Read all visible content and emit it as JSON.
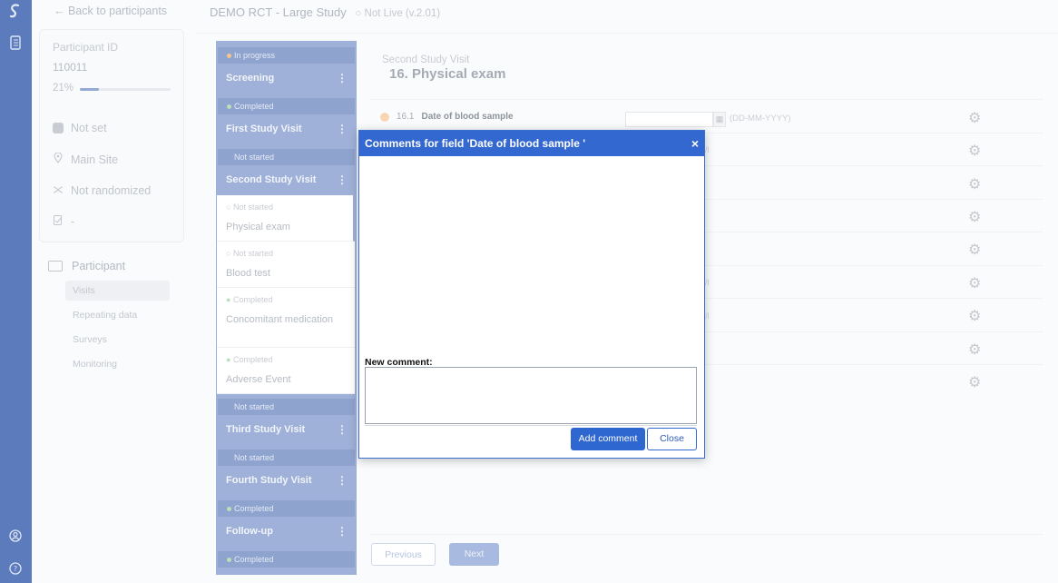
{
  "rail": {
    "icons": [
      "logo-icon",
      "notebook-icon",
      "user-icon",
      "help-icon"
    ]
  },
  "participant": {
    "back_label": "← Back to participants",
    "id_label": "Participant ID",
    "id_value": "110011",
    "progress_text": "21%",
    "progress_value": 0.21,
    "status": "Not set",
    "site": "Main Site",
    "randomization": "Not randomized",
    "extra": "-"
  },
  "nav": {
    "heading": "Participant",
    "items": [
      "Visits",
      "Repeating data",
      "Surveys",
      "Monitoring"
    ]
  },
  "header": {
    "study": "DEMO RCT - Large Study",
    "status": "Not Live (v.2.01)"
  },
  "visits": [
    {
      "status": "In progress",
      "name": "Screening"
    },
    {
      "status": "Completed",
      "name": "First Study Visit"
    },
    {
      "status": "Not started",
      "name": "Second Study Visit"
    },
    {
      "status": "Not started",
      "name": "Third Study Visit"
    },
    {
      "status": "Not started",
      "name": "Fourth Study Visit"
    },
    {
      "status": "Completed",
      "name": "Follow-up"
    },
    {
      "status": "Completed"
    }
  ],
  "forms": [
    {
      "status": "Not started",
      "name": "Physical exam"
    },
    {
      "status": "Not started",
      "name": "Blood test"
    },
    {
      "status": "Completed",
      "name": "Concomitant medication"
    },
    {
      "status": "Completed",
      "name": "Adverse Event"
    }
  ],
  "main": {
    "visit_title": "Second Study Visit",
    "form_title": "16. Physical exam",
    "question_number": "16.1",
    "question_label": "Date of blood sample",
    "date_hint": "(DD-MM-YYYY)",
    "prev_label": "Previous",
    "next_label": "Next"
  },
  "dialog": {
    "title": "Comments for field 'Date of blood sample '",
    "close_x": "×",
    "new_comment_label": "New comment:",
    "new_comment_value": "",
    "add_label": "Add comment",
    "close_label": "Close"
  }
}
